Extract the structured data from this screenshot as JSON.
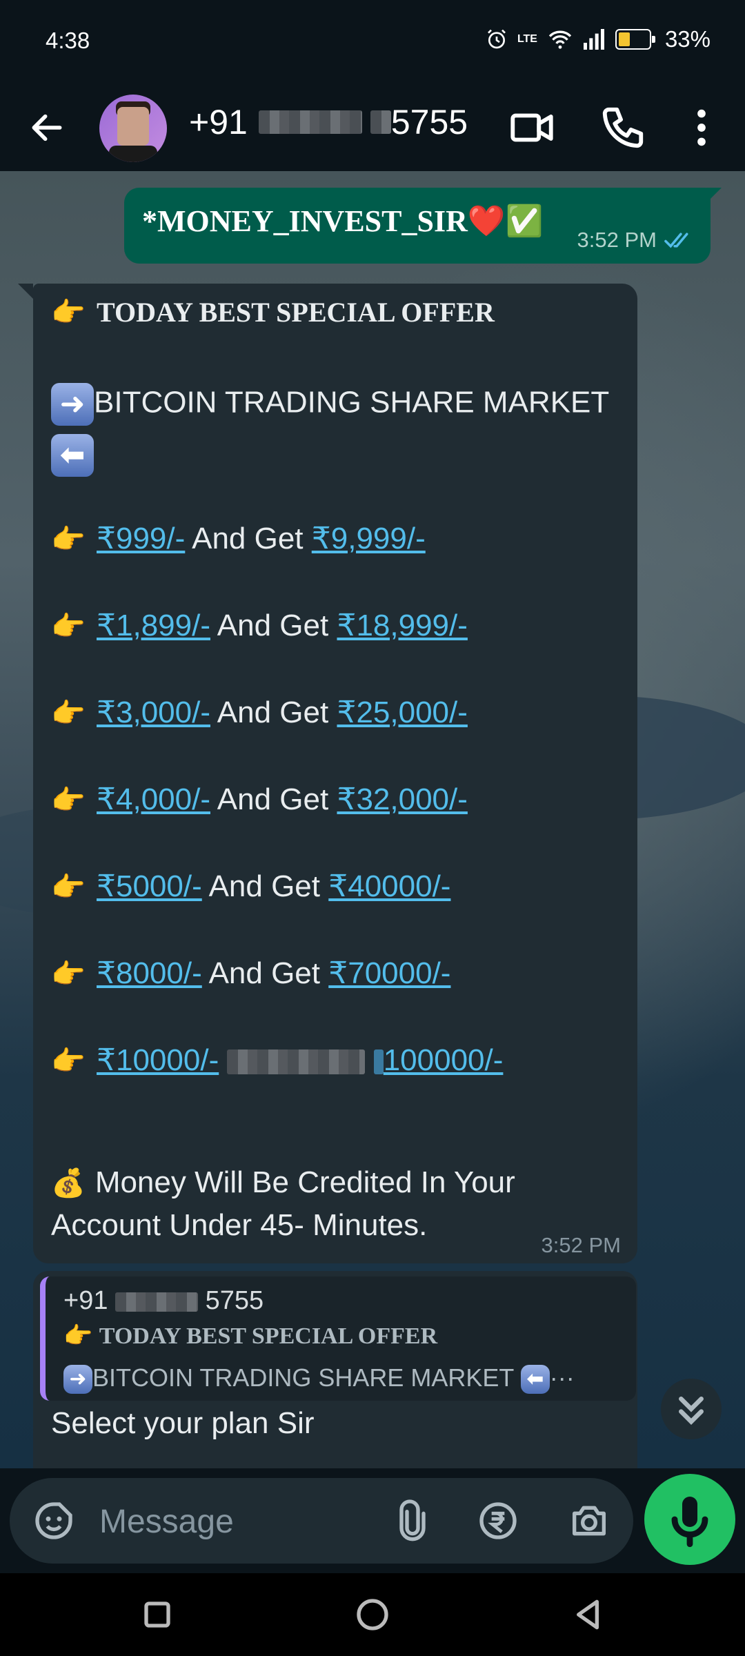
{
  "status_bar": {
    "time": "4:38",
    "battery": "33%",
    "network": "LTE"
  },
  "header": {
    "contact_prefix": "+91",
    "contact_suffix": "5755",
    "icons": [
      "back-arrow-icon",
      "video-call-icon",
      "voice-call-icon",
      "more-vert-icon"
    ]
  },
  "messages": {
    "outgoing": {
      "text": "*MONEY_INVEST_SIR",
      "emojis": "❤️✅",
      "time": "3:52 PM",
      "status": "read"
    },
    "incoming": {
      "headline": "TODAY BEST SPECIAL OFFER",
      "subhead": "BITCOIN TRADING SHARE MARKET",
      "connector": "And Get",
      "offers": [
        {
          "pay": "₹999/-",
          "get": "₹9,999/-"
        },
        {
          "pay": "₹1,899/-",
          "get": "₹18,999/-"
        },
        {
          "pay": "₹3,000/-",
          "get": "₹25,000/-"
        },
        {
          "pay": "₹4,000/-",
          "get": "₹32,000/-"
        },
        {
          "pay": "₹5000/-",
          "get": "₹40000/-"
        },
        {
          "pay": "₹8000/-",
          "get": "₹70000/-"
        },
        {
          "pay": "₹10000/-",
          "get": "100000/-"
        }
      ],
      "footer_line1": "Money Will Be Credited In Your",
      "footer_line2": "Account Under 45- Minutes.",
      "time": "3:52 PM"
    },
    "reply": {
      "quoted_sender_prefix": "+91",
      "quoted_sender_suffix": "5755",
      "quoted_line1": "TODAY BEST SPECIAL OFFER",
      "quoted_line2": "BITCOIN TRADING SHARE MARKET",
      "text": "Select your plan Sir"
    }
  },
  "composer": {
    "placeholder": "Message"
  },
  "colors": {
    "accent": "#21c063",
    "link": "#53bdeb",
    "outgoing_bubble": "#005c4b",
    "incoming_bubble": "#202c33"
  }
}
